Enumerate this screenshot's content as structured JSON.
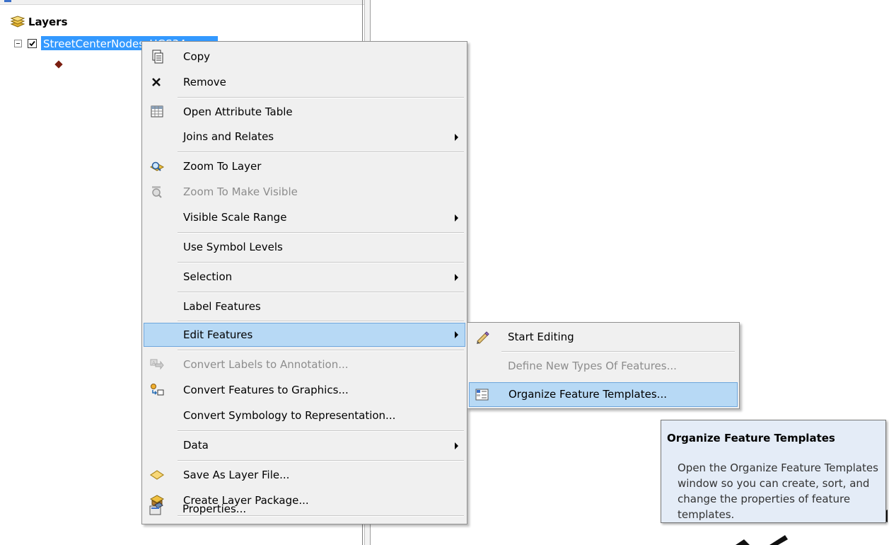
{
  "toc": {
    "layers_label": "Layers",
    "layer_name": "StreetCenterNodes_UGS34"
  },
  "context_menu": {
    "items": [
      {
        "label": "Copy",
        "icon": "copy-icon",
        "enabled": true
      },
      {
        "label": "Remove",
        "icon": "remove-icon",
        "enabled": true
      },
      {
        "label": "Open Attribute Table",
        "icon": "table-icon",
        "enabled": true
      },
      {
        "label": "Joins and Relates",
        "icon": "",
        "enabled": true,
        "submenu": true
      },
      {
        "label": "Zoom To Layer",
        "icon": "zoom-to-layer-icon",
        "enabled": true
      },
      {
        "label": "Zoom To Make Visible",
        "icon": "zoom-to-make-visible-icon",
        "enabled": false
      },
      {
        "label": "Visible Scale Range",
        "icon": "",
        "enabled": true,
        "submenu": true
      },
      {
        "label": "Use Symbol Levels",
        "icon": "",
        "enabled": true
      },
      {
        "label": "Selection",
        "icon": "",
        "enabled": true,
        "submenu": true
      },
      {
        "label": "Label Features",
        "icon": "",
        "enabled": true
      },
      {
        "label": "Edit Features",
        "icon": "",
        "enabled": true,
        "submenu": true,
        "highlighted": true
      },
      {
        "label": "Convert Labels to Annotation...",
        "icon": "convert-labels-icon",
        "enabled": false
      },
      {
        "label": "Convert Features to Graphics...",
        "icon": "convert-features-icon",
        "enabled": true
      },
      {
        "label": "Convert Symbology to Representation...",
        "icon": "",
        "enabled": true
      },
      {
        "label": "Data",
        "icon": "",
        "enabled": true,
        "submenu": true
      },
      {
        "label": "Save As Layer File...",
        "icon": "save-layer-file-icon",
        "enabled": true
      },
      {
        "label": "Create Layer Package...",
        "icon": "layer-package-icon",
        "enabled": true
      },
      {
        "label": "Properties...",
        "icon": "properties-icon",
        "enabled": true
      }
    ]
  },
  "submenu": {
    "items": [
      {
        "label": "Start Editing",
        "icon": "pencil-icon",
        "enabled": true
      },
      {
        "label": "Define New Types Of Features...",
        "icon": "",
        "enabled": false
      },
      {
        "label": "Organize Feature Templates...",
        "icon": "templates-icon",
        "enabled": true,
        "highlighted": true
      }
    ]
  },
  "tooltip": {
    "title": "Organize Feature Templates",
    "body": "Open the Organize Feature Templates window so you can create, sort, and change the properties of feature templates."
  }
}
